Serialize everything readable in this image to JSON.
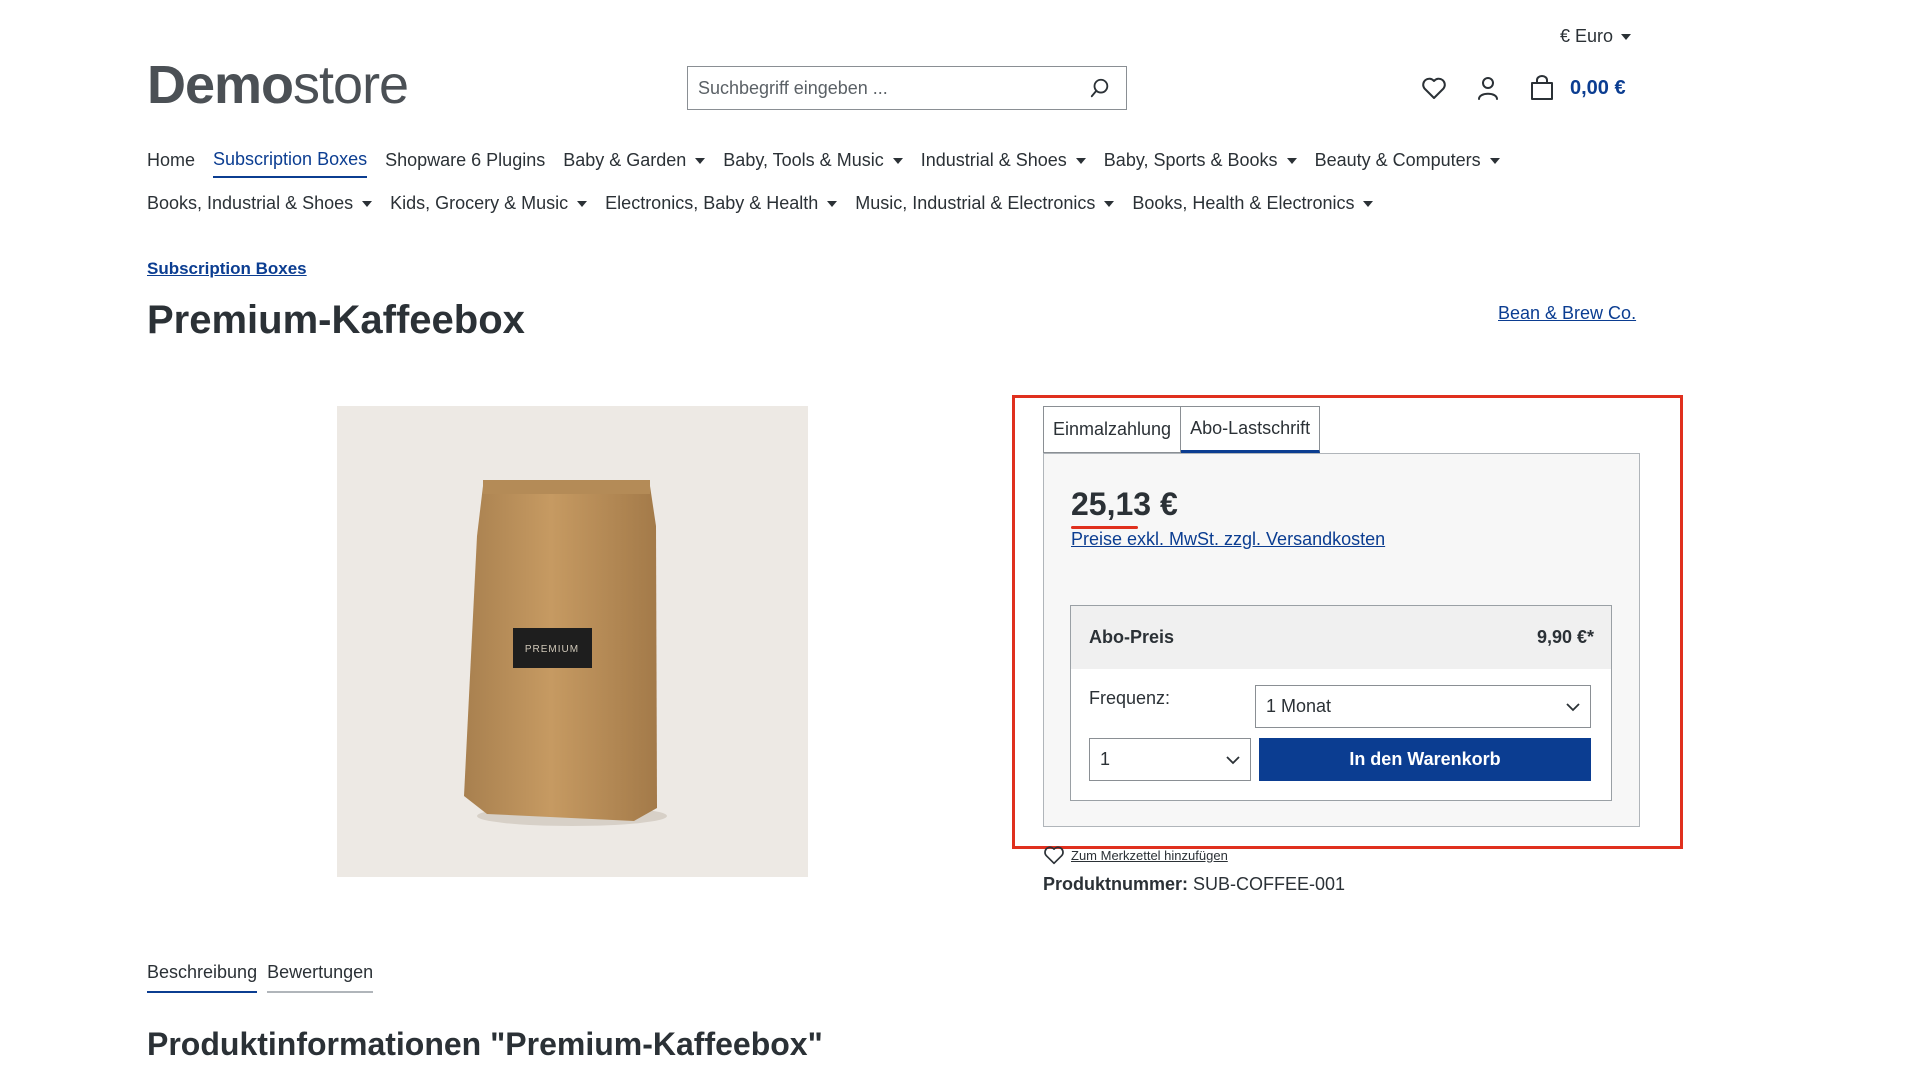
{
  "header": {
    "currency_label": "€ Euro",
    "logo_bold": "Demo",
    "logo_light": "store",
    "search_placeholder": "Suchbegriff eingeben ...",
    "cart_total": "0,00 €"
  },
  "nav": {
    "row1": [
      {
        "label": "Home",
        "dropdown": false,
        "active": false
      },
      {
        "label": "Subscription Boxes",
        "dropdown": false,
        "active": true
      },
      {
        "label": "Shopware 6 Plugins",
        "dropdown": false,
        "active": false
      },
      {
        "label": "Baby & Garden",
        "dropdown": true,
        "active": false
      },
      {
        "label": "Baby, Tools & Music",
        "dropdown": true,
        "active": false
      },
      {
        "label": "Industrial & Shoes",
        "dropdown": true,
        "active": false
      },
      {
        "label": "Baby, Sports & Books",
        "dropdown": true,
        "active": false
      },
      {
        "label": "Beauty & Computers",
        "dropdown": true,
        "active": false
      }
    ],
    "row2": [
      {
        "label": "Books, Industrial & Shoes",
        "dropdown": true,
        "active": false
      },
      {
        "label": "Kids, Grocery & Music",
        "dropdown": true,
        "active": false
      },
      {
        "label": "Electronics, Baby & Health",
        "dropdown": true,
        "active": false
      },
      {
        "label": "Music, Industrial & Electronics",
        "dropdown": true,
        "active": false
      },
      {
        "label": "Books, Health & Electronics",
        "dropdown": true,
        "active": false
      }
    ]
  },
  "product": {
    "breadcrumb": "Subscription Boxes",
    "title": "Premium-Kaffeebox",
    "manufacturer": "Bean & Brew Co.",
    "image_label": "PREMIUM",
    "payment_tabs": [
      "Einmalzahlung",
      "Abo-Lastschrift"
    ],
    "active_payment_tab": "Abo-Lastschrift",
    "price": "25,13 €",
    "tax_note": "Preise exkl. MwSt. zzgl. Versandkosten",
    "abo_label": "Abo-Preis",
    "abo_price": "9,90 €*",
    "frequency_label": "Frequenz:",
    "frequency_value": "1 Monat",
    "quantity_value": "1",
    "add_to_cart": "In den Warenkorb",
    "wishlist_text": "Zum Merkzettel hinzufügen",
    "product_number_label": "Produktnummer:",
    "product_number": "SUB-COFFEE-001"
  },
  "details": {
    "tabs": [
      "Beschreibung",
      "Bewertungen"
    ],
    "active_tab": "Beschreibung",
    "section_title": "Produktinformationen \"Premium-Kaffeebox\""
  },
  "colors": {
    "brand": "#0b3d91",
    "highlight": "#e0301e",
    "text": "#2b3136"
  }
}
